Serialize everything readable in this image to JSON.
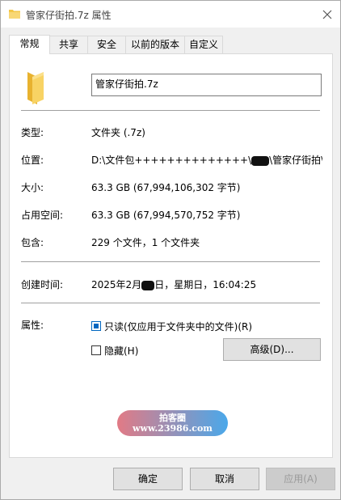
{
  "window": {
    "title": "管家仔街拍.7z 属性",
    "close_icon": "close-icon"
  },
  "tabs": [
    {
      "label": "常规",
      "active": true
    },
    {
      "label": "共享",
      "active": false
    },
    {
      "label": "安全",
      "active": false
    },
    {
      "label": "以前的版本",
      "active": false
    },
    {
      "label": "自定义",
      "active": false
    }
  ],
  "general": {
    "file_name": "管家仔街拍.7z",
    "rows": {
      "type": {
        "label": "类型:",
        "value": "文件夹 (.7z)"
      },
      "location": {
        "label": "位置:",
        "value_prefix": "D:\\文件包++++++++++++++\\",
        "value_suffix": "\\管家仔街拍\\管"
      },
      "size": {
        "label": "大小:",
        "value": "63.3 GB (67,994,106,302 字节)"
      },
      "size_on_disk": {
        "label": "占用空间:",
        "value": "63.3 GB (67,994,570,752 字节)"
      },
      "contains": {
        "label": "包含:",
        "value": "229 个文件，1 个文件夹"
      },
      "created": {
        "label": "创建时间:",
        "value_prefix": "2025年2月",
        "value_suffix": "日，星期日，16:04:25"
      }
    },
    "attributes": {
      "label": "属性:",
      "readonly": {
        "label": "只读(仅应用于文件夹中的文件)(R)",
        "checked": true
      },
      "hidden": {
        "label": "隐藏(H)",
        "checked": false
      },
      "advanced_button": "高级(D)..."
    }
  },
  "watermark": {
    "line1": "拍客圈",
    "line2": "www.23986.com"
  },
  "footer": {
    "ok": "确定",
    "cancel": "取消",
    "apply": "应用(A)"
  },
  "colors": {
    "accent": "#0067c0",
    "folder": "#f3c647"
  }
}
